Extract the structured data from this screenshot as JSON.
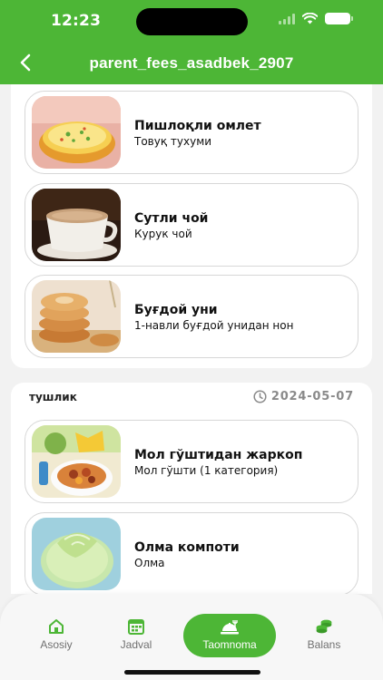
{
  "status_bar": {
    "time": "12:23"
  },
  "header": {
    "title": "parent_fees_asadbek_2907"
  },
  "colors": {
    "brand": "#4db636",
    "date_gray": "#8a8a8a"
  },
  "sections": [
    {
      "items": [
        {
          "title": "Пишлоқли омлет",
          "subtitle": "Товуқ тухуми",
          "image": "cheese-omelette-image"
        },
        {
          "title": "Сутли чой",
          "subtitle": "Курук чой",
          "image": "milk-tea-image"
        },
        {
          "title": "Буғдой уни",
          "subtitle": "1-навли буғдой унидан нон",
          "image": "bread-image"
        }
      ]
    },
    {
      "meal": "тушлик",
      "date": "2024-05-07",
      "items": [
        {
          "title": "Мол гўштидан жаркоп",
          "subtitle": "Мол гўшти (1 категория)",
          "image": "beef-stew-image"
        },
        {
          "title": "Олма компоти",
          "subtitle": "Олма",
          "image": "apple-compote-image"
        }
      ]
    }
  ],
  "nav": {
    "items": [
      {
        "label": "Asosiy",
        "icon": "home-icon"
      },
      {
        "label": "Jadval",
        "icon": "calendar-icon"
      },
      {
        "label": "Taomnoma",
        "icon": "food-tray-icon",
        "active": true
      },
      {
        "label": "Balans",
        "icon": "coins-icon"
      }
    ]
  }
}
